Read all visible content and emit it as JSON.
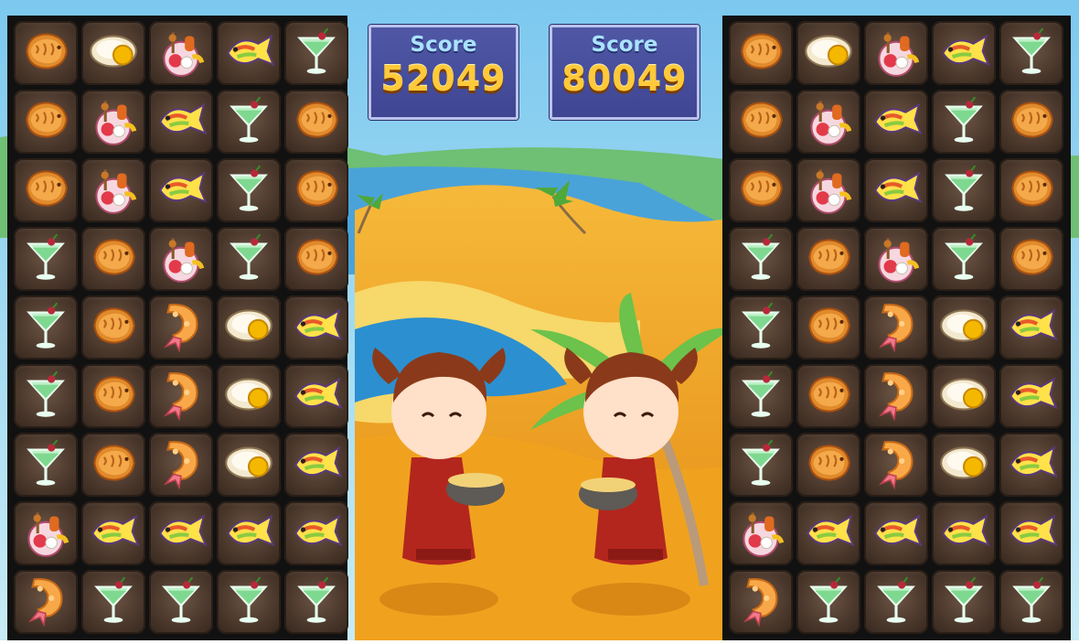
{
  "scores": [
    {
      "label": "Score",
      "value": "52049"
    },
    {
      "label": "Score",
      "value": "80049"
    }
  ],
  "boards": {
    "left": [
      [
        "fish-cake",
        "egg-dish",
        "skewer-platter",
        "yellow-fish",
        "cocktail"
      ],
      [
        "fish-cake",
        "skewer-platter",
        "yellow-fish",
        "cocktail",
        "fish-cake"
      ],
      [
        "fish-cake",
        "skewer-platter",
        "yellow-fish",
        "cocktail",
        "fish-cake"
      ],
      [
        "cocktail",
        "fish-cake",
        "skewer-platter",
        "cocktail",
        "fish-cake"
      ],
      [
        "cocktail",
        "fish-cake",
        "fried-shrimp",
        "egg-dish",
        "yellow-fish"
      ],
      [
        "cocktail",
        "fish-cake",
        "fried-shrimp",
        "egg-dish",
        "yellow-fish"
      ],
      [
        "cocktail",
        "fish-cake",
        "fried-shrimp",
        "egg-dish",
        "yellow-fish"
      ],
      [
        "skewer-platter",
        "yellow-fish",
        "yellow-fish",
        "yellow-fish",
        "yellow-fish"
      ],
      [
        "fried-shrimp",
        "cocktail",
        "cocktail",
        "cocktail",
        "cocktail"
      ]
    ],
    "right": [
      [
        "fish-cake",
        "egg-dish",
        "skewer-platter",
        "yellow-fish",
        "cocktail"
      ],
      [
        "fish-cake",
        "skewer-platter",
        "yellow-fish",
        "cocktail",
        "fish-cake"
      ],
      [
        "fish-cake",
        "skewer-platter",
        "yellow-fish",
        "cocktail",
        "fish-cake"
      ],
      [
        "cocktail",
        "fish-cake",
        "skewer-platter",
        "cocktail",
        "fish-cake"
      ],
      [
        "cocktail",
        "fish-cake",
        "fried-shrimp",
        "egg-dish",
        "yellow-fish"
      ],
      [
        "cocktail",
        "fish-cake",
        "fried-shrimp",
        "egg-dish",
        "yellow-fish"
      ],
      [
        "cocktail",
        "fish-cake",
        "fried-shrimp",
        "egg-dish",
        "yellow-fish"
      ],
      [
        "skewer-platter",
        "yellow-fish",
        "yellow-fish",
        "yellow-fish",
        "yellow-fish"
      ],
      [
        "fried-shrimp",
        "cocktail",
        "cocktail",
        "cocktail",
        "cocktail"
      ]
    ]
  },
  "colors": {
    "sky": "#5fb8e6",
    "sand": "#f2a524",
    "sea": "#2a86c8",
    "board": "#111111",
    "score_bg": "#4a50a0",
    "score_text": "#ffc93a",
    "score_label": "#a9e3ff",
    "dress": "#b3261e"
  }
}
